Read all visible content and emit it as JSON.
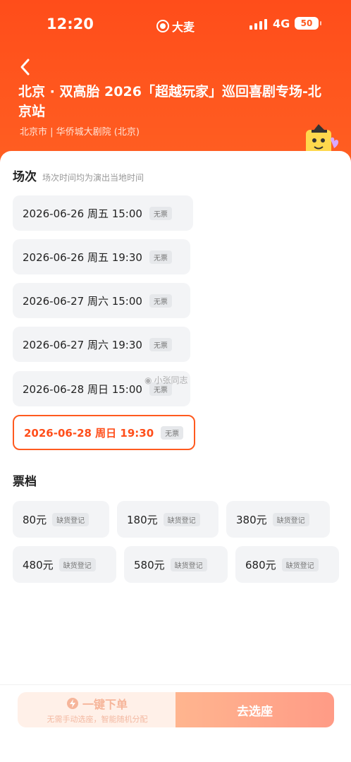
{
  "status_bar": {
    "time": "12:20",
    "brand": "大麦",
    "network": "4G",
    "battery": "50"
  },
  "header": {
    "title": "北京 · 双高胎 2026「超越玩家」巡回喜剧专场-北京站",
    "venue": "北京市 | 华侨城大剧院 (北京)"
  },
  "sessions_section": {
    "title": "场次",
    "note": "场次时间均为演出当地时间",
    "items": [
      {
        "label": "2026-06-26  周五 15:00",
        "tag": "无票"
      },
      {
        "label": "2026-06-26 周五 19:30",
        "tag": "无票"
      },
      {
        "label": "2026-06-27 周六 15:00",
        "tag": "无票"
      },
      {
        "label": "2026-06-27 周六 19:30",
        "tag": "无票"
      },
      {
        "label": "2026-06-28 周日 15:00",
        "tag": "无票"
      },
      {
        "label": "2026-06-28 周日 19:30",
        "tag": "无票",
        "selected": true
      }
    ]
  },
  "watermark": "小张同志",
  "tiers_section": {
    "title": "票档",
    "items": [
      {
        "price": "80元",
        "tag": "缺货登记"
      },
      {
        "price": "180元",
        "tag": "缺货登记"
      },
      {
        "price": "380元",
        "tag": "缺货登记"
      },
      {
        "price": "480元",
        "tag": "缺货登记"
      },
      {
        "price": "580元",
        "tag": "缺货登记"
      },
      {
        "price": "680元",
        "tag": "缺货登记"
      }
    ]
  },
  "bottom_bar": {
    "quick_label": "一键下单",
    "quick_sub": "无需手动选座，智能随机分配",
    "seat_label": "去选座"
  },
  "colors": {
    "brand_orange": "#ff5a1f",
    "selected_text": "#ff4e1a",
    "card_bg": "#f3f4f6"
  }
}
